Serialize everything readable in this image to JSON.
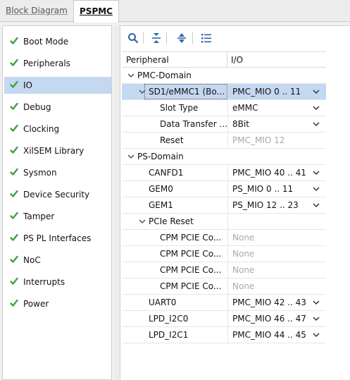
{
  "tabs": [
    {
      "label": "Block Diagram",
      "active": false
    },
    {
      "label": "PSPMC",
      "active": true
    }
  ],
  "sidebar": {
    "items": [
      {
        "label": "Boot Mode"
      },
      {
        "label": "Peripherals"
      },
      {
        "label": "IO",
        "selected": true
      },
      {
        "label": "Debug"
      },
      {
        "label": "Clocking"
      },
      {
        "label": "XilSEM Library"
      },
      {
        "label": "Sysmon"
      },
      {
        "label": "Device Security"
      },
      {
        "label": "Tamper"
      },
      {
        "label": "PS PL Interfaces"
      },
      {
        "label": "NoC"
      },
      {
        "label": "Interrupts"
      },
      {
        "label": "Power"
      }
    ]
  },
  "toolbar": {
    "icons": [
      "search-icon",
      "collapse-all-icon",
      "expand-all-icon",
      "list-icon"
    ]
  },
  "table": {
    "headers": {
      "peripheral": "Peripheral",
      "io": "I/O"
    },
    "rows": [
      {
        "name": "PMC-Domain",
        "io": "",
        "level": 0,
        "expander": "expanded",
        "dropdown": false
      },
      {
        "name": "SD1/eMMC1 (Bo...",
        "io": "PMC_MIO 0 .. 11",
        "level": 1,
        "expander": "expanded",
        "dropdown": true,
        "selected": true
      },
      {
        "name": "Slot Type",
        "io": "eMMC",
        "level": 2,
        "dropdown": true
      },
      {
        "name": "Data Transfer ...",
        "io": "8Bit",
        "level": 2,
        "dropdown": true
      },
      {
        "name": "Reset",
        "io": "PMC_MIO 12",
        "level": 2,
        "dropdown": false,
        "disabled": true
      },
      {
        "name": "PS-Domain",
        "io": "",
        "level": 0,
        "expander": "expanded",
        "dropdown": false
      },
      {
        "name": "CANFD1",
        "io": "PMC_MIO 40 .. 41",
        "level": 1,
        "dropdown": true
      },
      {
        "name": "GEM0",
        "io": "PS_MIO 0 .. 11",
        "level": 1,
        "dropdown": true
      },
      {
        "name": "GEM1",
        "io": "PS_MIO 12 .. 23",
        "level": 1,
        "dropdown": true
      },
      {
        "name": "PCIe Reset",
        "io": "",
        "level": 1,
        "expander": "expanded",
        "dropdown": false
      },
      {
        "name": "CPM PCIE Co...",
        "io": "None",
        "level": 2,
        "dropdown": false,
        "disabled": true
      },
      {
        "name": "CPM PCIE Co...",
        "io": "None",
        "level": 2,
        "dropdown": false,
        "disabled": true
      },
      {
        "name": "CPM PCIE Co...",
        "io": "None",
        "level": 2,
        "dropdown": false,
        "disabled": true
      },
      {
        "name": "CPM PCIE Co...",
        "io": "None",
        "level": 2,
        "dropdown": false,
        "disabled": true
      },
      {
        "name": "UART0",
        "io": "PMC_MIO 42 .. 43",
        "level": 1,
        "dropdown": true
      },
      {
        "name": "LPD_I2C0",
        "io": "PMC_MIO 46 .. 47",
        "level": 1,
        "dropdown": true
      },
      {
        "name": "LPD_I2C1",
        "io": "PMC_MIO 44 .. 45",
        "level": 1,
        "dropdown": true
      }
    ]
  },
  "colors": {
    "check": "#3aa63a",
    "selection": "#c5d8f1",
    "toolbar_icon": "#2f63a8",
    "disabled_text": "#a8a8a8"
  }
}
